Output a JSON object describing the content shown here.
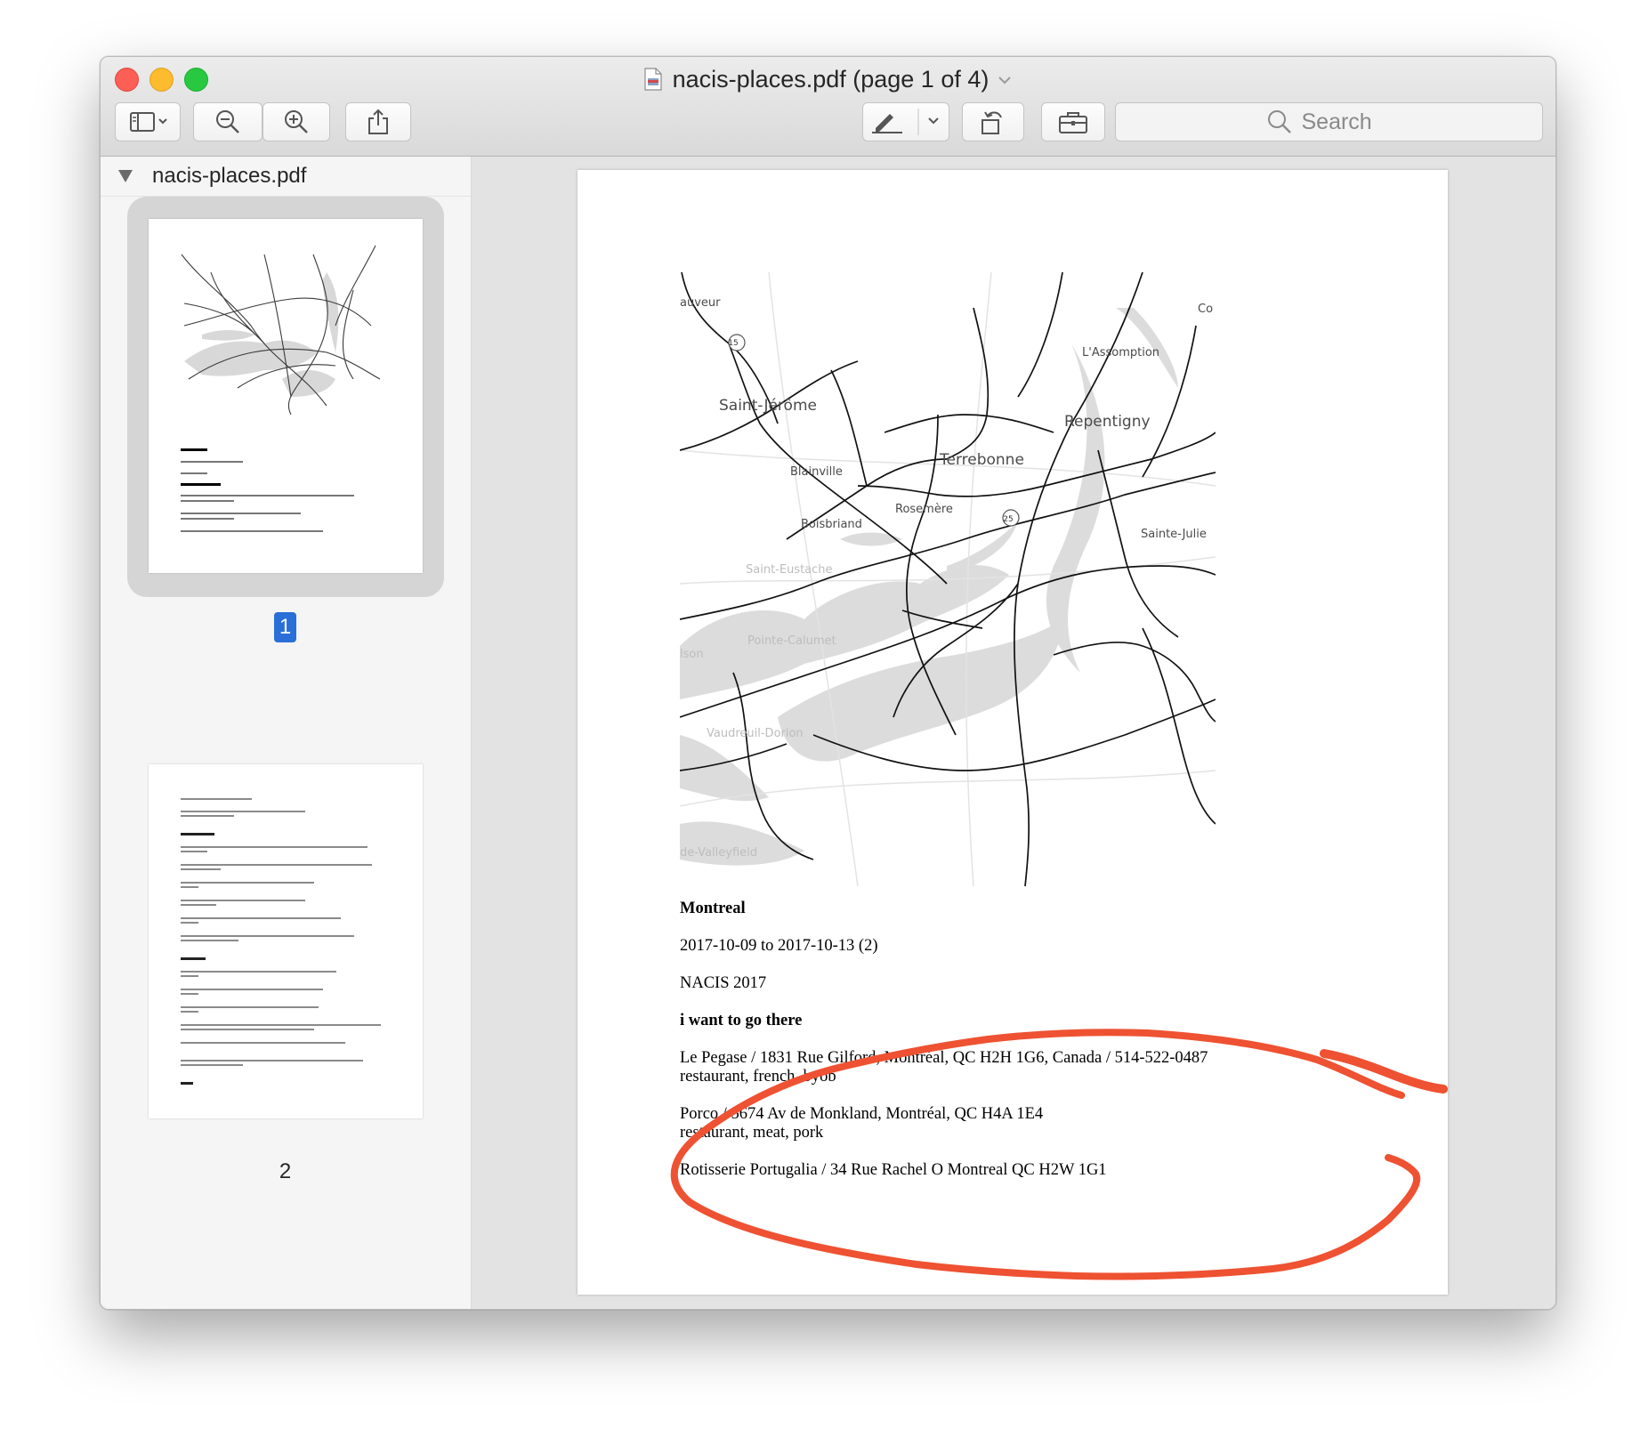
{
  "window": {
    "title": "nacis-places.pdf (page 1 of 4)"
  },
  "toolbar": {
    "buttons": [
      {
        "name": "sidebar-toggle",
        "icon": "sidebar-icon"
      },
      {
        "name": "zoom-out",
        "icon": "zoom-out-icon"
      },
      {
        "name": "zoom-in",
        "icon": "zoom-in-icon"
      },
      {
        "name": "share",
        "icon": "share-icon"
      },
      {
        "name": "markup",
        "icon": "pen-icon"
      },
      {
        "name": "rotate",
        "icon": "rotate-icon"
      },
      {
        "name": "toolbox",
        "icon": "toolbox-icon"
      }
    ],
    "search_placeholder": "Search"
  },
  "sidebar": {
    "file_name": "nacis-places.pdf",
    "pages": [
      {
        "label": "1",
        "selected": true
      },
      {
        "label": "2",
        "selected": false
      }
    ]
  },
  "document": {
    "map_labels": [
      "Saint-Jérôme",
      "L'Assomption",
      "Repentigny",
      "Terrebonne",
      "Blainville",
      "Rosemère",
      "Boisbriand",
      "Sainte-Julie",
      "Saint-Eustache",
      "Pointe-Calumet",
      "Vaudreuil-Dorion",
      "auveur",
      "Co",
      "lson",
      "de-Valleyfield"
    ],
    "highway_labels": [
      "15",
      "25"
    ],
    "heading": "Montreal",
    "dates": "2017-10-09 to 2017-10-13 (2)",
    "event": "NACIS 2017",
    "section": "i want to go there",
    "places": [
      {
        "line1": "Le Pegase / 1831 Rue Gilford, Montréal, QC H2H 1G6, Canada / 514-522-0487",
        "line2": "restaurant, french, byob"
      },
      {
        "line1": "Porco / 5674 Av de Monkland, Montréal, QC H4A 1E4",
        "line2": "restaurant, meat, pork"
      },
      {
        "line1": "Rotisserie Portugalia / 34 Rue Rachel O Montreal QC H2W 1G1",
        "line2": ""
      }
    ],
    "annotation_color": "#ee5232"
  }
}
